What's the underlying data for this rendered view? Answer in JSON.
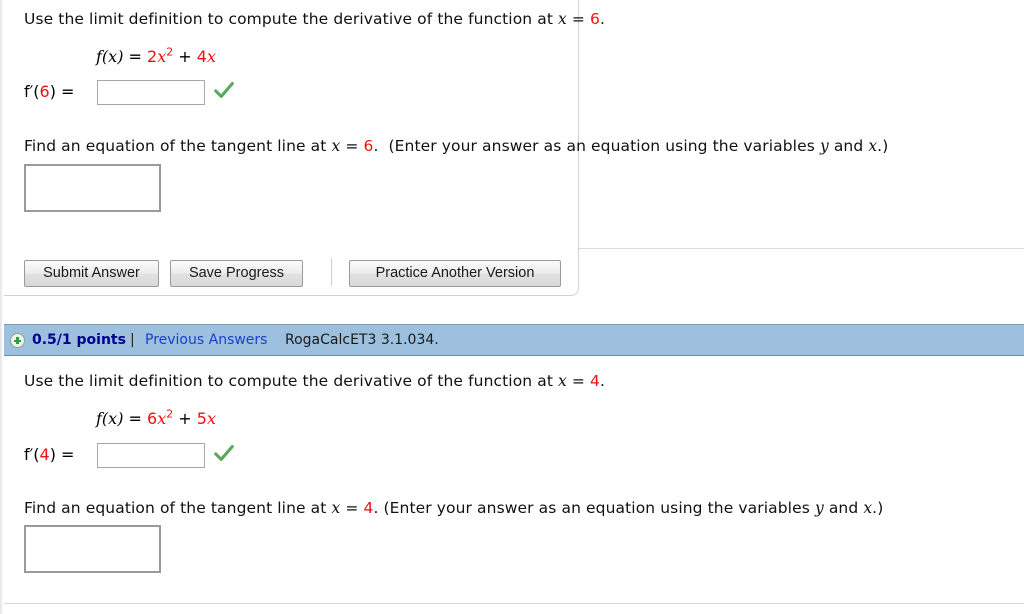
{
  "problem_1": {
    "prompt_before": "Use the limit definition to compute the derivative of the function at",
    "prompt_var": "x",
    "prompt_eq": "=",
    "prompt_value": "6",
    "prompt_after": ".",
    "formula_lhs": "f(x)",
    "formula_eq": "=",
    "formula_coef1": "2",
    "formula_x1": "x",
    "formula_exp": "2",
    "formula_plus": "+",
    "formula_coef2": "4",
    "formula_x2": "x",
    "derivative_label_f": "f",
    "derivative_label_prime": "′(",
    "derivative_label_point": "6",
    "derivative_label_close": ") =",
    "answer_value": "",
    "answer_placeholder": "",
    "check_icon": "green-check-icon",
    "tangent_prompt_before": "Find an equation of the tangent line at",
    "tangent_var": "x",
    "tangent_eq": "=",
    "tangent_value": "6",
    "tangent_after": ".",
    "tangent_note": "(Enter your answer as an equation using the variables",
    "tangent_note_var_y": "y",
    "tangent_note_and": "and",
    "tangent_note_var_x": "x",
    "tangent_note_close": ".)",
    "tangent_answer_value": "",
    "buttons": {
      "submit": "Submit Answer",
      "save": "Save Progress",
      "practice": "Practice Another Version"
    }
  },
  "status_bar": {
    "plus_icon": "plus-circle-icon",
    "points": "0.5/1 points",
    "separator": "|",
    "previous_answers": "Previous Answers",
    "question_code": "RogaCalcET3 3.1.034."
  },
  "problem_2": {
    "prompt_before": "Use the limit definition to compute the derivative of the function at",
    "prompt_var": "x",
    "prompt_eq": "=",
    "prompt_value": "4",
    "prompt_after": ".",
    "formula_lhs": "f(x)",
    "formula_eq": "=",
    "formula_coef1": "6",
    "formula_x1": "x",
    "formula_exp": "2",
    "formula_plus": "+",
    "formula_coef2": "5",
    "formula_x2": "x",
    "derivative_label_f": "f",
    "derivative_label_prime": "′(",
    "derivative_label_point": "4",
    "derivative_label_close": ") =",
    "answer_value": "",
    "check_icon": "green-check-icon",
    "tangent_prompt_before": "Find an equation of the tangent line at",
    "tangent_var": "x",
    "tangent_eq": "=",
    "tangent_value": "4",
    "tangent_after": ".",
    "tangent_note": "(Enter your answer as an equation using the variables",
    "tangent_note_var_y": "y",
    "tangent_note_and": "and",
    "tangent_note_var_x": "x",
    "tangent_note_close": ".)",
    "tangent_answer_value": ""
  },
  "colors": {
    "accent_red": "#ee1111",
    "status_bar_bg": "#9cc0dd",
    "link_blue": "#1a3fcc",
    "points_blue": "#00008f",
    "check_green": "#5aa85a"
  }
}
